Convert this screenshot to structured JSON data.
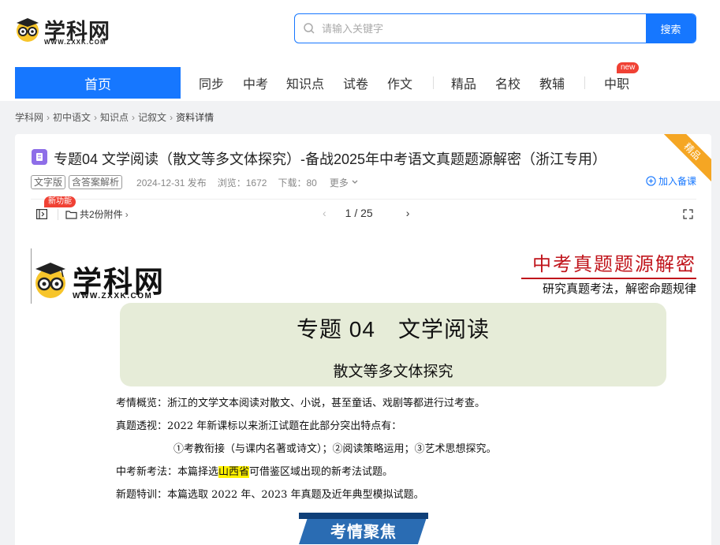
{
  "header": {
    "logo_text": "学科网",
    "logo_sub": "WWW.ZXXK.COM",
    "search_placeholder": "请输入关键字",
    "search_button": "搜索"
  },
  "nav": {
    "home": "首页",
    "items": [
      "同步",
      "中考",
      "知识点",
      "试卷",
      "作文",
      "精品",
      "名校",
      "教辅",
      "中职"
    ],
    "new_badge": "new"
  },
  "breadcrumb": [
    "学科网",
    "初中语文",
    "知识点",
    "记叙文",
    "资料详情"
  ],
  "doc": {
    "ribbon": "精品",
    "title": "专题04 文学阅读（散文等多文体探究）-备战2025年中考语文真题题源解密（浙江专用）",
    "tags": [
      "文字版",
      "含答案解析"
    ],
    "published": "2024-12-31 发布",
    "views": "浏览：1672",
    "downloads": "下载：80",
    "more": "更多",
    "add_collect": "加入备课"
  },
  "toolbar": {
    "new_feature": "新功能",
    "attachments": "共2份附件",
    "page_current": "1",
    "page_total": "25",
    "page_display": "1 / 25"
  },
  "preview": {
    "logo_text": "学科网",
    "logo_sub": "WWW.ZXXK.COM",
    "brand_title": "中考真题题源解密",
    "brand_sub": "研究真题考法，解密命题规律",
    "main_title": "专题 04　文学阅读",
    "sub_title": "散文等多文体探究",
    "lines": [
      {
        "label": "考情概览：",
        "text": "浙江的文学文本阅读对散文、小说，甚至童话、戏剧等都进行过考查。"
      },
      {
        "label": "真题透视：",
        "text": "2022 年新课标以来浙江试题在此部分突出特点有："
      },
      {
        "label": "",
        "text": "①考教衔接（与课内名著或诗文）；②阅读策略运用；③艺术思想探究。"
      },
      {
        "label": "中考新考法：",
        "text_before": "本篇择选",
        "highlight": "山西省",
        "text_after": "可借鉴区域出现的新考法试题。"
      },
      {
        "label": "新题特训：",
        "text": "本篇选取 2022 年、2023 年真题及近年典型模拟试题。"
      }
    ],
    "section_banner": "考情聚焦"
  },
  "colors": {
    "accent": "#1677ff",
    "badge_red": "#f04134",
    "ribbon_gold": "#f5a623",
    "brand_red": "#c0141b",
    "title_box": "#e6ecd8"
  }
}
